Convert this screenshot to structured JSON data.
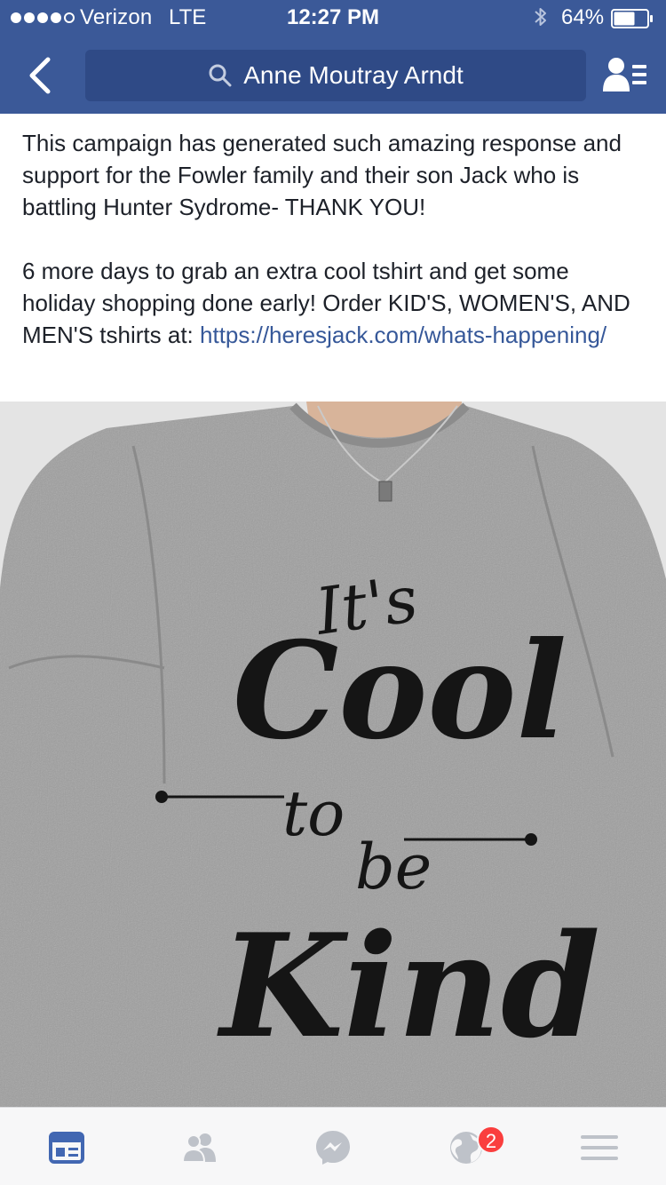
{
  "status_bar": {
    "carrier": "Verizon",
    "network": "LTE",
    "time": "12:27 PM",
    "battery_percent": "64%",
    "battery_level": 0.64,
    "signal_bars": 4
  },
  "nav": {
    "search_text": "Anne Moutray Arndt",
    "back_icon": "chevron-left-icon",
    "search_icon": "search-icon",
    "friends_icon": "friend-requests-icon"
  },
  "post": {
    "paragraph1": "This campaign has generated such amazing response and support for the Fowler family and their son Jack who is battling Hunter Sydrome- THANK YOU!",
    "paragraph2_text": "6 more days to grab an extra cool tshirt and get some holiday shopping done early! Order KID'S, WOMEN'S, AND MEN'S tshirts at: ",
    "link": "https://heresjack.com/whats-happening/",
    "image_text": {
      "line1": "It's",
      "line2": "Cool",
      "line3": "to",
      "line4": "be",
      "line5": "Kind"
    }
  },
  "tab_bar": {
    "tabs": [
      {
        "name": "news-feed",
        "icon": "news-feed-icon",
        "active": true
      },
      {
        "name": "friends",
        "icon": "friends-icon",
        "active": false
      },
      {
        "name": "messenger",
        "icon": "messenger-icon",
        "active": false
      },
      {
        "name": "notifications",
        "icon": "globe-icon",
        "active": false,
        "badge": "2"
      },
      {
        "name": "more",
        "icon": "menu-icon",
        "active": false
      }
    ]
  },
  "colors": {
    "brand_blue": "#3b5998",
    "search_bg": "#2f4a86",
    "link": "#365899",
    "active_tab": "#4267b2",
    "inactive_tab": "#bec2c9",
    "badge": "#fa3e3e"
  }
}
